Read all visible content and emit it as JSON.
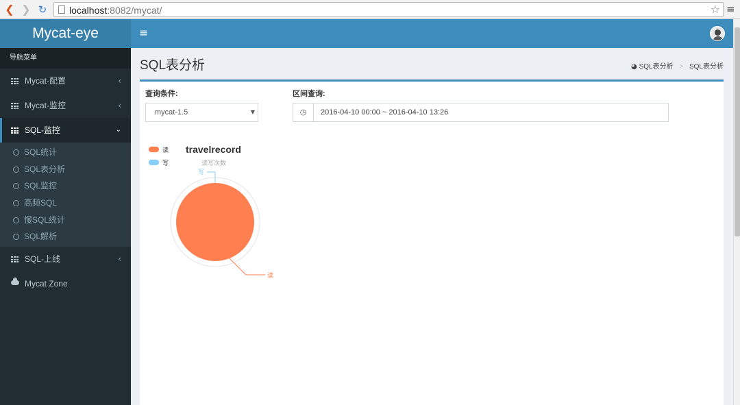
{
  "browser": {
    "url_host": "localhost",
    "url_rest": ":8082/mycat/"
  },
  "app": {
    "logo": "Mycat-eye"
  },
  "sidebar": {
    "header": "导航菜单",
    "items": [
      {
        "label": "Mycat-配置",
        "expanded": false
      },
      {
        "label": "Mycat-监控",
        "expanded": false
      },
      {
        "label": "SQL-监控",
        "expanded": true,
        "active": true
      },
      {
        "label": "SQL-上线",
        "expanded": false
      },
      {
        "label": "Mycat Zone"
      }
    ],
    "sql_monitor_children": [
      "SQL统计",
      "SQL表分析",
      "SQL监控",
      "高频SQL",
      "慢SQL统计",
      "SQL解析"
    ]
  },
  "content": {
    "title": "SQL表分析",
    "breadcrumb": [
      "SQL表分析",
      "SQL表分析"
    ],
    "query": {
      "condition_label": "查询条件:",
      "condition_value": "mycat-1.5",
      "range_label": "区间查询:",
      "range_value": "2016-04-10 00:00 ~ 2016-04-10 13:26"
    }
  },
  "chart_data": {
    "type": "pie",
    "title": "travelrecord",
    "subtitle": "读写次数",
    "legend": [
      "读",
      "写"
    ],
    "legend_position": "top-left",
    "slices": [
      {
        "name": "读",
        "value": 100,
        "color": "#ff7f50"
      },
      {
        "name": "写",
        "value": 0,
        "color": "#87cefa"
      }
    ]
  },
  "colors": {
    "brand": "#3c8dbc",
    "logo_bg": "#367fa9",
    "sidebar_bg": "#222d32"
  }
}
